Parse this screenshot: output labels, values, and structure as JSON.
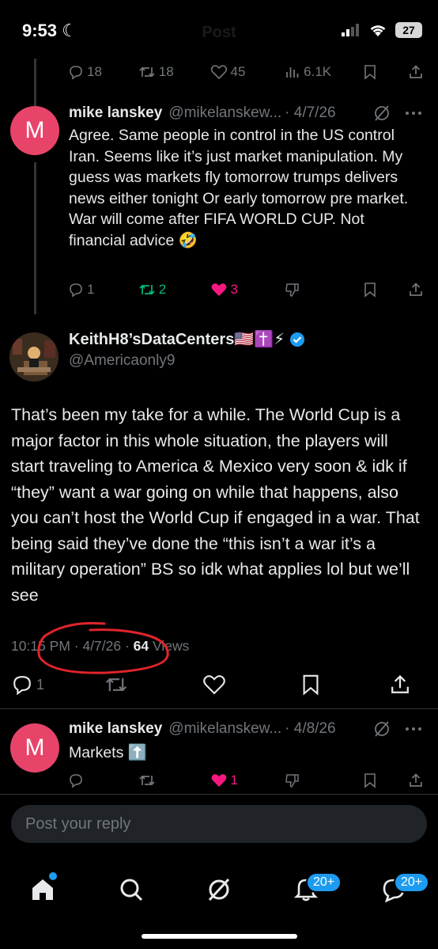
{
  "status_bar": {
    "time": "9:53",
    "faint_title": "Post",
    "battery": "27"
  },
  "prev_actions": {
    "replies": "18",
    "reposts": "18",
    "likes": "45",
    "views": "6.1K"
  },
  "reply1": {
    "avatar_letter": "M",
    "name": "mike lanskey",
    "handle": "@mikelanskew...",
    "date": "· 4/7/26",
    "text": "Agree. Same people in control in the US control Iran. Seems like it’s just market manipulation. My guess was markets fly tomorrow trumps delivers news either tonight Or early tomorrow pre market. War will come after FIFA WORLD CUP. Not financial advice 🤣",
    "replies": "1",
    "reposts": "2",
    "likes": "3"
  },
  "main_post": {
    "display_name": "KeithH8’sDataCenters🇺🇸✝️⚡",
    "handle": "@Americaonly9",
    "text": "That’s been my take for a while. The World Cup is a major factor in this whole situation, the players will start traveling to America & Mexico very soon & idk if “they” want a war going on while that happens, also you can’t host the World Cup if engaged in a war. That being said they’ve done the “this isn’t a war it’s a military operation” BS so idk what applies lol but we’ll see",
    "time": "10:15 PM · 4/7/26 · ",
    "views_count": "64",
    "views_label": " Views",
    "replies": "1"
  },
  "reply2": {
    "avatar_letter": "M",
    "name": "mike lanskey",
    "handle": "@mikelanskew...",
    "date": "· 4/8/26",
    "text": "Markets ⬆️",
    "likes": "1"
  },
  "reply_box": {
    "placeholder": "Post your reply"
  },
  "tabbar": {
    "notifications_badge": "20+",
    "messages_badge": "20+"
  },
  "colors": {
    "accent": "#1d9bf0",
    "like": "#f91880",
    "repost": "#00ba7c",
    "annotation": "#e0242b"
  }
}
